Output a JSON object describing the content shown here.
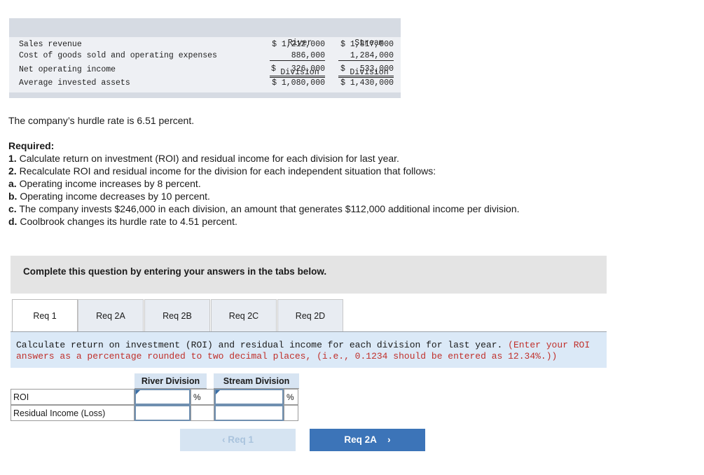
{
  "financials": {
    "col_headers": [
      {
        "line1": "River",
        "line2": "Division"
      },
      {
        "line1": "Stream",
        "line2": "Division"
      }
    ],
    "rows": [
      {
        "label": "Sales revenue",
        "river": "$ 1,212,000",
        "stream": "$ 1,817,000"
      },
      {
        "label": "Cost of goods sold and operating expenses",
        "river": "886,000",
        "stream": "1,284,000"
      },
      {
        "label": "Net operating income",
        "river_sign": "$",
        "river": "326,000",
        "stream_sign": "$",
        "stream": "533,000"
      },
      {
        "label": "Average invested assets",
        "river": "$ 1,080,000",
        "stream": "$ 1,430,000"
      }
    ]
  },
  "hurdle_text": "The company’s hurdle rate is 6.51 percent.",
  "required": {
    "heading": "Required:",
    "items": [
      {
        "prefix": "1.",
        "text": " Calculate return on investment (ROI) and residual income for each division for last year."
      },
      {
        "prefix": "2.",
        "text": " Recalculate ROI and residual income for the division for each independent situation that follows:"
      },
      {
        "prefix": "a.",
        "text": " Operating income increases by 8 percent."
      },
      {
        "prefix": "b.",
        "text": " Operating income decreases by 10 percent."
      },
      {
        "prefix": "c.",
        "text": " The company invests $246,000 in each division, an amount that generates $112,000 additional income per division."
      },
      {
        "prefix": "d.",
        "text": " Coolbrook changes its hurdle rate to 4.51 percent."
      }
    ]
  },
  "instruction_panel": "Complete this question by entering your answers in the tabs below.",
  "tabs": [
    {
      "label": "Req 1",
      "active": true
    },
    {
      "label": "Req 2A",
      "active": false
    },
    {
      "label": "Req 2B",
      "active": false
    },
    {
      "label": "Req 2C",
      "active": false
    },
    {
      "label": "Req 2D",
      "active": false
    }
  ],
  "tab_note": {
    "main": "Calculate return on investment (ROI) and residual income for each division for last year.",
    "hint": "(Enter your ROI answers as a percentage rounded to two decimal places, (i.e., 0.1234 should be entered as 12.34%.))"
  },
  "answer_grid": {
    "col_river": "River Division",
    "col_stream": "Stream Division",
    "row_roi": "ROI",
    "row_ri": "Residual Income (Loss)",
    "pct_symbol": "%",
    "river_roi_value": "",
    "stream_roi_value": "",
    "river_ri_value": "",
    "stream_ri_value": ""
  },
  "nav": {
    "prev_label": "Req 1",
    "next_label": "Req 2A"
  },
  "colors": {
    "accent": "#3c74b8",
    "hint_red": "#c0302b",
    "note_bg": "#dbe9f7"
  }
}
